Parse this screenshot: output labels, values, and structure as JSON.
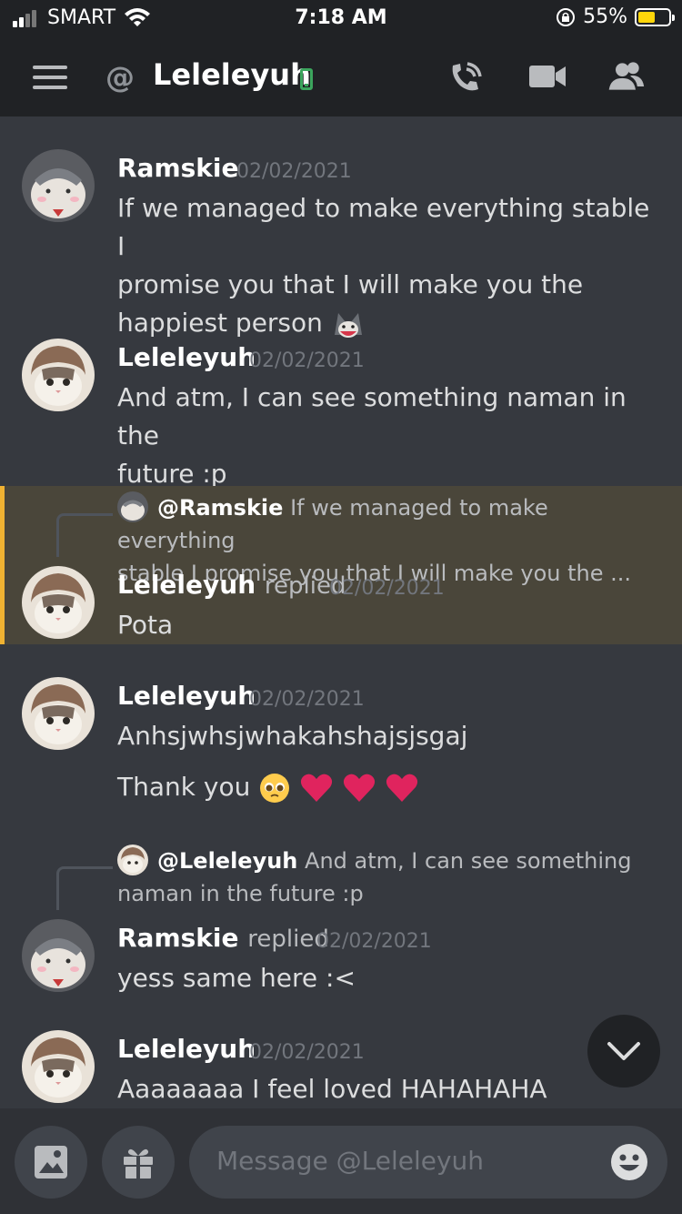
{
  "status_bar": {
    "carrier": "SMART",
    "time": "7:18 AM",
    "battery": "55%",
    "battery_level": 0.55,
    "signal_bars": 2
  },
  "header": {
    "dm_name": "Leleleyuh",
    "at_symbol": "@",
    "status": "mobile-online",
    "icons": [
      "menu-icon",
      "phone-call-icon",
      "video-camera-icon",
      "members-icon"
    ]
  },
  "messages": [
    {
      "author": "Ramskie",
      "timestamp": "02/02/2021",
      "lines": [
        "If we managed to make everything stable I",
        "promise you that I will make you the",
        "happiest person"
      ],
      "trailing_emoji": "cat-sticker-emoji"
    },
    {
      "author": "Leleleyuh",
      "timestamp": "02/02/2021",
      "lines": [
        "And atm, I can see something naman in the",
        "future :p"
      ]
    },
    {
      "reply_to_mention": "@Ramskie",
      "reply_to_line1": "If we managed to make everything",
      "reply_to_line2": "stable I promise you that I will make you the ...",
      "author": "Leleleyuh",
      "replied_label": "replied",
      "timestamp": "02/02/2021",
      "text": "Pota",
      "highlighted": true
    },
    {
      "author": "Leleleyuh",
      "timestamp": "02/02/2021",
      "text": "Anhsjwhsjwhakahshajsjsgaj",
      "text2": "Thank you",
      "emojis": [
        "pleading-face-emoji",
        "red-heart-emoji",
        "red-heart-emoji",
        "red-heart-emoji"
      ]
    },
    {
      "reply_to_mention": "@Leleleyuh",
      "reply_to_line1": "And atm, I can see something",
      "reply_to_line2": "naman in the future :p",
      "author": "Ramskie",
      "replied_label": "replied",
      "timestamp": "02/02/2021",
      "text": "yess same here :<"
    },
    {
      "author": "Leleleyuh",
      "timestamp": "02/02/2021",
      "text": "Aaaaaaaa I feel loved HAHAHAHA"
    }
  ],
  "composer": {
    "placeholder": "Message @Leleleyuh"
  },
  "colors": {
    "background": "#36393f",
    "header": "#202225",
    "highlight": "#4a463a",
    "highlight_border": "#f0b232",
    "online_mobile": "#3ba55d",
    "heart": "#e0245e"
  }
}
